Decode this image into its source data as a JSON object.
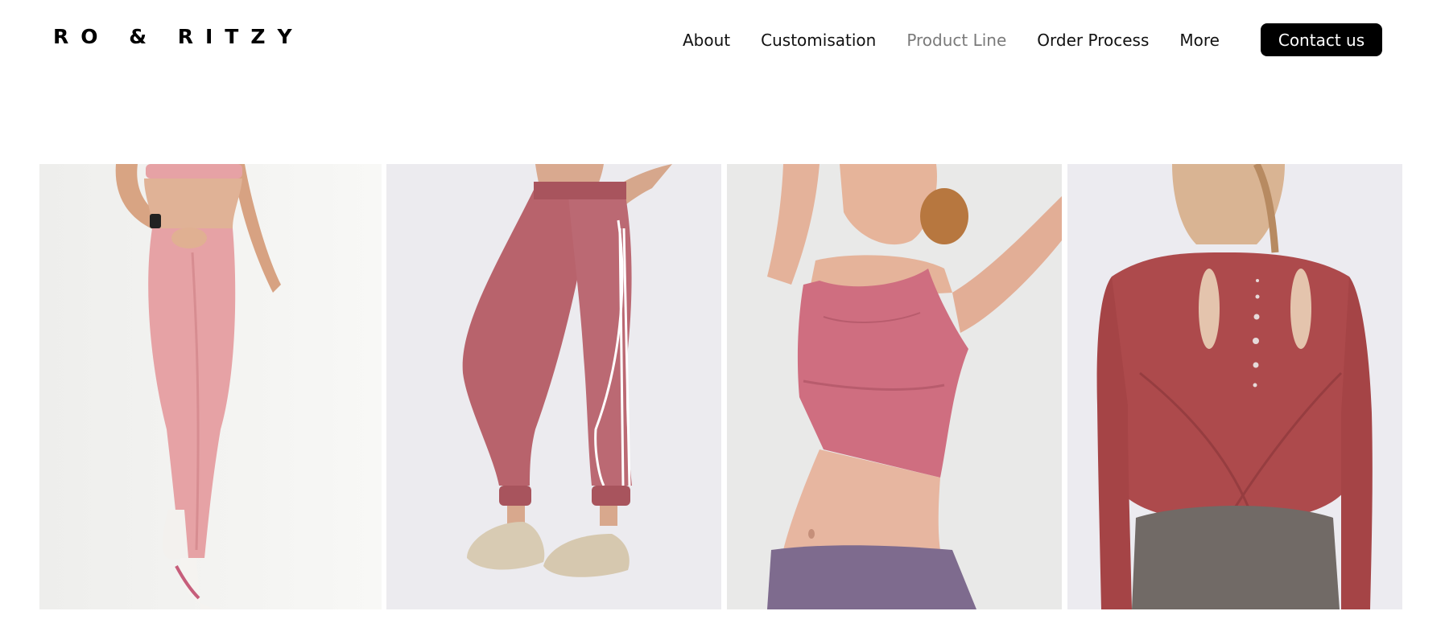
{
  "brand": {
    "logo_text": "RO & RITZY"
  },
  "nav": {
    "items": [
      {
        "label": "About",
        "active": false
      },
      {
        "label": "Customisation",
        "active": false
      },
      {
        "label": "Product Line",
        "active": true
      },
      {
        "label": "Order Process",
        "active": false
      },
      {
        "label": "More",
        "active": false
      }
    ],
    "contact_label": "Contact us"
  },
  "gallery": {
    "products": [
      {
        "name": "pink leggings",
        "icon": "leggings-photo"
      },
      {
        "name": "mauve joggers",
        "icon": "joggers-photo"
      },
      {
        "name": "pink sports bra",
        "icon": "sports-bra-photo"
      },
      {
        "name": "red long sleeve top",
        "icon": "long-sleeve-top-photo"
      }
    ]
  },
  "colors": {
    "accent": "#000000",
    "active_nav": "#7a7a7a",
    "leggings": "#e6a2a5",
    "joggers": "#b8636c",
    "bra": "#cf6e80",
    "top": "#ad4a4c"
  }
}
